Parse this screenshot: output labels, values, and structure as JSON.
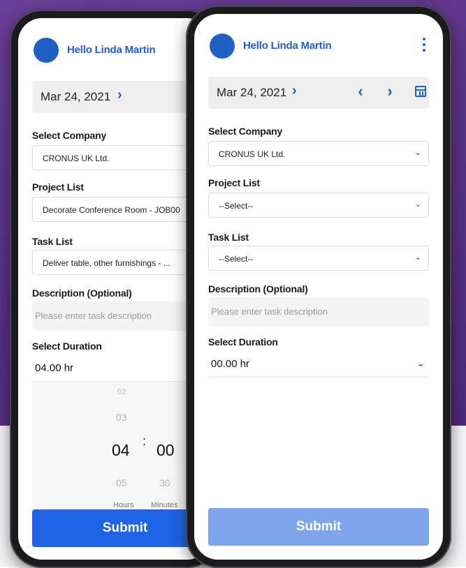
{
  "greeting": "Hello Linda Martin",
  "date": "Mar 24, 2021",
  "icons": {
    "date_forward": "chevron-right-icon",
    "prev": "chevron-left-icon",
    "next": "chevron-right-icon",
    "calendar": "calendar-icon",
    "menu": "more-vertical-icon",
    "dropdown": "chevron-down-icon"
  },
  "labels": {
    "company": "Select Company",
    "project": "Project List",
    "task": "Task List",
    "description": "Description (Optional)",
    "duration": "Select Duration"
  },
  "description_placeholder": "Please enter task description",
  "submit_label": "Submit",
  "left": {
    "company": "CRONUS UK Ltd.",
    "project": "Decorate Conference Room - JOB00",
    "task": "Deliver table, other furnishings - ...",
    "duration": "04.00 hr",
    "picker": {
      "hours": [
        "02",
        "03",
        "04",
        "05"
      ],
      "minutes": [
        "00",
        "30"
      ],
      "separator": ":",
      "hours_label": "Hours",
      "minutes_label": "Minutes"
    }
  },
  "right": {
    "company": "CRONUS UK Ltd.",
    "project": "--Select--",
    "task": "--Select--",
    "duration": "00.00 hr"
  },
  "colors": {
    "accent": "#1f5fc6",
    "submit_active": "#1f63e6",
    "submit_disabled": "#7fa6ec",
    "background_purple": "#5a3287"
  }
}
